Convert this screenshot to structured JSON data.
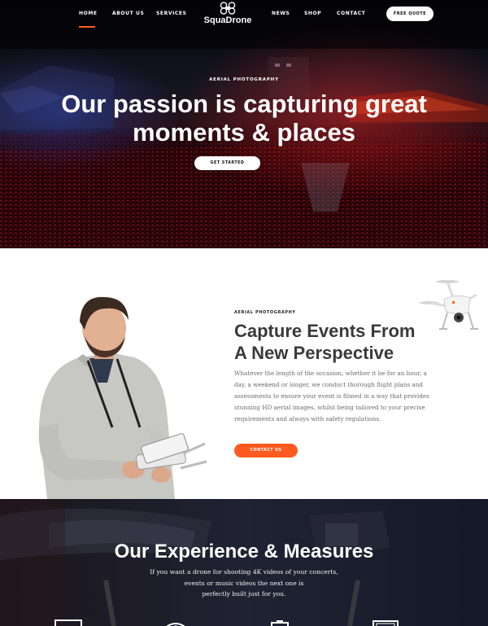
{
  "nav": {
    "items": [
      {
        "label": "HOME",
        "active": true
      },
      {
        "label": "ABOUT US"
      },
      {
        "label": "SERVICES"
      },
      {
        "label": "NEWS"
      },
      {
        "label": "SHOP"
      },
      {
        "label": "CONTACT"
      }
    ],
    "logo_text": "SquaDrone",
    "quote_button": "FREE QUOTE"
  },
  "hero": {
    "eyebrow": "AERIAL PHOTOGRAPHY",
    "title_line1": "Our passion is capturing great",
    "title_line2": "moments & places",
    "cta": "GET STARTED"
  },
  "about": {
    "eyebrow": "AERIAL PHOTOGRAPHY",
    "title_line1": "Capture Events From",
    "title_line2": "A New Perspective",
    "body_lines": [
      "Whatever the length of the occasion, whether it be for an hour, a",
      "day, a weekend or longer, we conduct thorough flight plans and",
      "assessments to ensure your event is filmed in a way that provides",
      "stunning HD aerial images, whilst being tailored to your precise",
      "requirements and always with safety regulations."
    ],
    "cta": "CONTACT US"
  },
  "experience": {
    "title": "Our Experience & Measures",
    "text_lines": [
      "If you want a drone for shooting 4K videos of your concerts,",
      "events or music videos the next one is",
      "perfectly built just for you."
    ],
    "icons": [
      "monitor-icon",
      "camera-icon",
      "battery-icon",
      "screen-icon"
    ]
  },
  "colors": {
    "accent": "#ff5a1f",
    "hero_bg": "#0a0a12",
    "heading_dark": "#3a3a3a",
    "body_gray": "#6b6b6b"
  }
}
